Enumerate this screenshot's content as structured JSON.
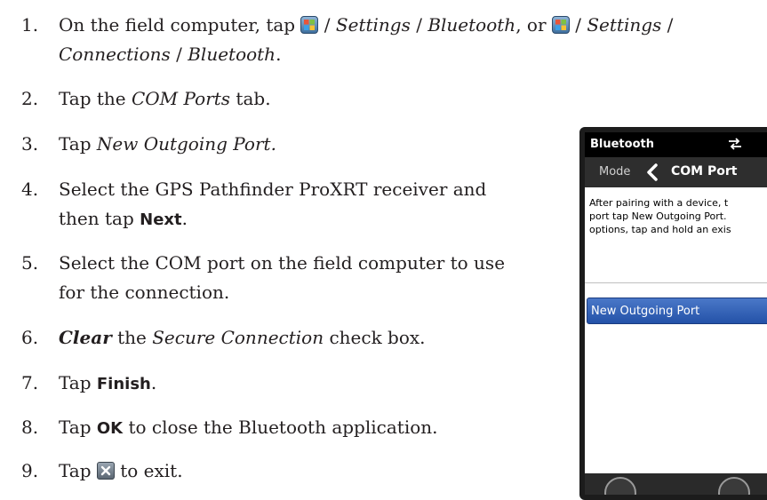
{
  "steps": [
    {
      "num": "1.",
      "p1": "On the field computer, tap ",
      "p2": " / ",
      "p3": "Settings",
      "p4": " / ",
      "p5": "Bluetooth",
      "p6": ", or ",
      "p7": " / ",
      "p8": "Settings",
      "p9": " /",
      "p10": "Connections",
      "p11": " / ",
      "p12": "Bluetooth",
      "p13": "."
    },
    {
      "num": "2.",
      "p1": "Tap the ",
      "p2": "COM Ports",
      "p3": " tab."
    },
    {
      "num": "3.",
      "p1": "Tap ",
      "p2": "New Outgoing Port."
    },
    {
      "num": "4.",
      "p1": "Select the GPS Pathfinder ProXRT receiver and",
      "p2": "then tap ",
      "p3": "Next",
      "p4": "."
    },
    {
      "num": "5.",
      "p1": "Select the COM port on the field computer to use",
      "p2": "for the connection."
    },
    {
      "num": "6.",
      "p1": "Clear",
      "p2": " the ",
      "p3": "Secure Connection",
      "p4": " check box."
    },
    {
      "num": "7.",
      "p1": "Tap ",
      "p2": "Finish",
      "p3": "."
    },
    {
      "num": "8.",
      "p1": "Tap ",
      "p2": "OK",
      "p3": " to close the Bluetooth application."
    },
    {
      "num": "9.",
      "p1": "Tap ",
      "p2": " to exit."
    }
  ],
  "icons": {
    "start": "windows-start-icon",
    "close": "close-x-icon"
  },
  "device": {
    "title": "Bluetooth",
    "tab_prev": "Mode",
    "tab_current": "COM Port",
    "help_text": "After pairing with a device, t\nport tap New Outgoing Port.\noptions, tap and hold an exis",
    "list_item": "New Outgoing Port"
  },
  "colors": {
    "text": "#231f20",
    "selection": "#2452a8",
    "titlebar": "#000000"
  }
}
